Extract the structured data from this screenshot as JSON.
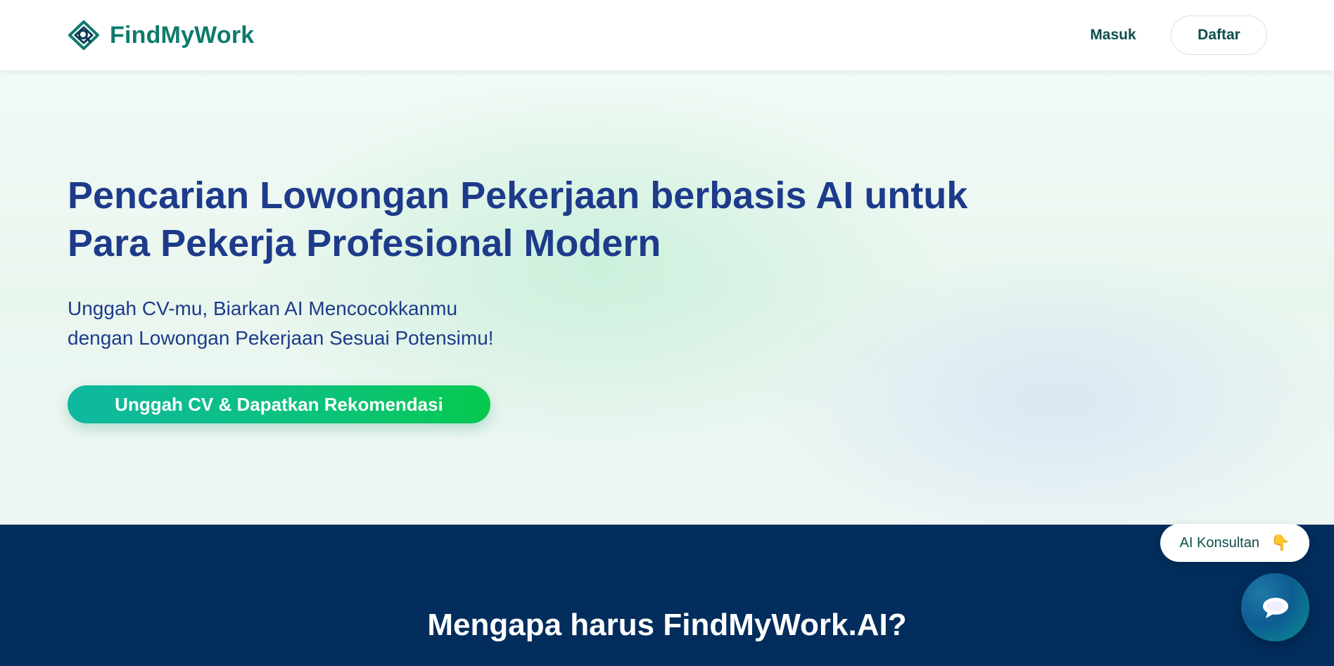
{
  "brand": {
    "name": "FindMyWork",
    "color": "#0f7a6b"
  },
  "nav": {
    "login_label": "Masuk",
    "register_label": "Daftar"
  },
  "hero": {
    "title_line1": "Pencarian Lowongan Pekerjaan berbasis AI untuk",
    "title_line2": "Para Pekerja Profesional Modern",
    "subtitle_line1": "Unggah CV-mu, Biarkan AI Mencocokkanmu",
    "subtitle_line2": "dengan Lowongan Pekerjaan Sesuai Potensimu!",
    "cta_label": "Unggah CV & Dapatkan Rekomendasi",
    "title_color": "#1e3a8a",
    "cta_gradient": [
      "#0fb8a0",
      "#06c94f"
    ]
  },
  "why": {
    "title": "Mengapa harus FindMyWork.AI?",
    "background": "#022d5c"
  },
  "chat_widget": {
    "consult_label": "AI Konsultan",
    "consult_icon": "pointing-down-icon",
    "fab_icon": "chat-bubble-icon"
  }
}
